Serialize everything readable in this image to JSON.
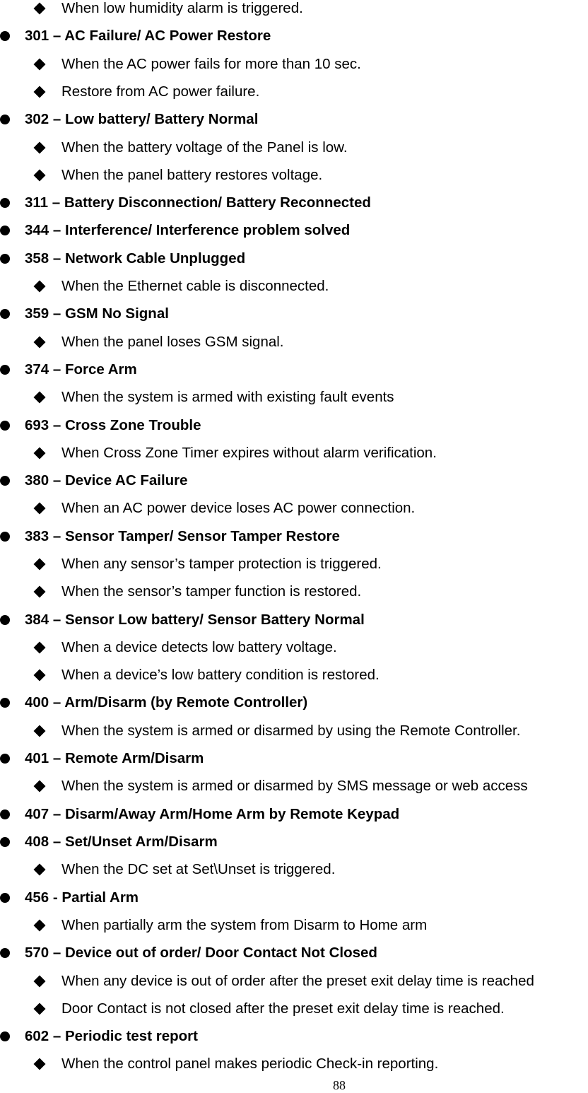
{
  "items": [
    {
      "type": "sub",
      "text": "When low humidity alarm is triggered."
    },
    {
      "type": "head",
      "text": "301 – AC Failure/ AC Power Restore"
    },
    {
      "type": "sub",
      "text": "When the AC power fails for more than 10 sec."
    },
    {
      "type": "sub",
      "text": "Restore from AC power failure."
    },
    {
      "type": "head",
      "text": "302 – Low battery/ Battery Normal"
    },
    {
      "type": "sub",
      "text": "When the battery voltage of the Panel is low."
    },
    {
      "type": "sub",
      "text": "When the panel battery restores voltage."
    },
    {
      "type": "head",
      "text": "311 – Battery Disconnection/ Battery Reconnected"
    },
    {
      "type": "head",
      "text": "344 – Interference/ Interference problem solved"
    },
    {
      "type": "head",
      "text": "358 – Network Cable Unplugged"
    },
    {
      "type": "sub",
      "text": "When the Ethernet cable is disconnected."
    },
    {
      "type": "head",
      "text": "359 – GSM No Signal"
    },
    {
      "type": "sub",
      "text": "When the panel loses GSM signal."
    },
    {
      "type": "head",
      "text": "374 – Force Arm"
    },
    {
      "type": "sub",
      "text": "When the system is armed with existing fault events"
    },
    {
      "type": "head",
      "text": "693 – Cross Zone Trouble"
    },
    {
      "type": "sub",
      "text": "When Cross Zone Timer expires without alarm verification."
    },
    {
      "type": "head",
      "text": "380 – Device AC Failure"
    },
    {
      "type": "sub",
      "text": "When an AC power device loses AC power connection."
    },
    {
      "type": "head",
      "text": "383 – Sensor Tamper/ Sensor Tamper Restore"
    },
    {
      "type": "sub",
      "text": "When any sensor’s tamper protection is triggered."
    },
    {
      "type": "sub",
      "text": "When the sensor’s tamper function is restored."
    },
    {
      "type": "head",
      "text": "384 – Sensor Low battery/ Sensor Battery Normal"
    },
    {
      "type": "sub",
      "text": "When a device detects low battery voltage."
    },
    {
      "type": "sub",
      "text": "When a device’s low battery condition is restored."
    },
    {
      "type": "head",
      "text": "400 – Arm/Disarm (by Remote Controller)"
    },
    {
      "type": "sub",
      "text": "When the system is armed or disarmed by using the Remote Controller."
    },
    {
      "type": "head",
      "text": "401 – Remote Arm/Disarm"
    },
    {
      "type": "sub",
      "text": "When the system is armed or disarmed by SMS message or web access"
    },
    {
      "type": "head",
      "text": "407 – Disarm/Away Arm/Home Arm by Remote Keypad"
    },
    {
      "type": "head",
      "text": "408 – Set/Unset Arm/Disarm"
    },
    {
      "type": "sub",
      "text": "When the DC set at Set\\Unset is triggered."
    },
    {
      "type": "head",
      "text": "456 - Partial Arm"
    },
    {
      "type": "sub",
      "text": "When partially arm the system from Disarm to Home arm"
    },
    {
      "type": "head",
      "text": "570 – Device out of order/ Door Contact Not Closed"
    },
    {
      "type": "sub",
      "text": "When any device is out of order after the preset exit delay time is reached"
    },
    {
      "type": "sub",
      "text": "Door Contact is not closed after the preset exit delay time is reached."
    },
    {
      "type": "head",
      "text": "602 – Periodic test report"
    },
    {
      "type": "sub",
      "text": "When the control panel makes periodic Check-in reporting."
    }
  ],
  "page_number": "88"
}
